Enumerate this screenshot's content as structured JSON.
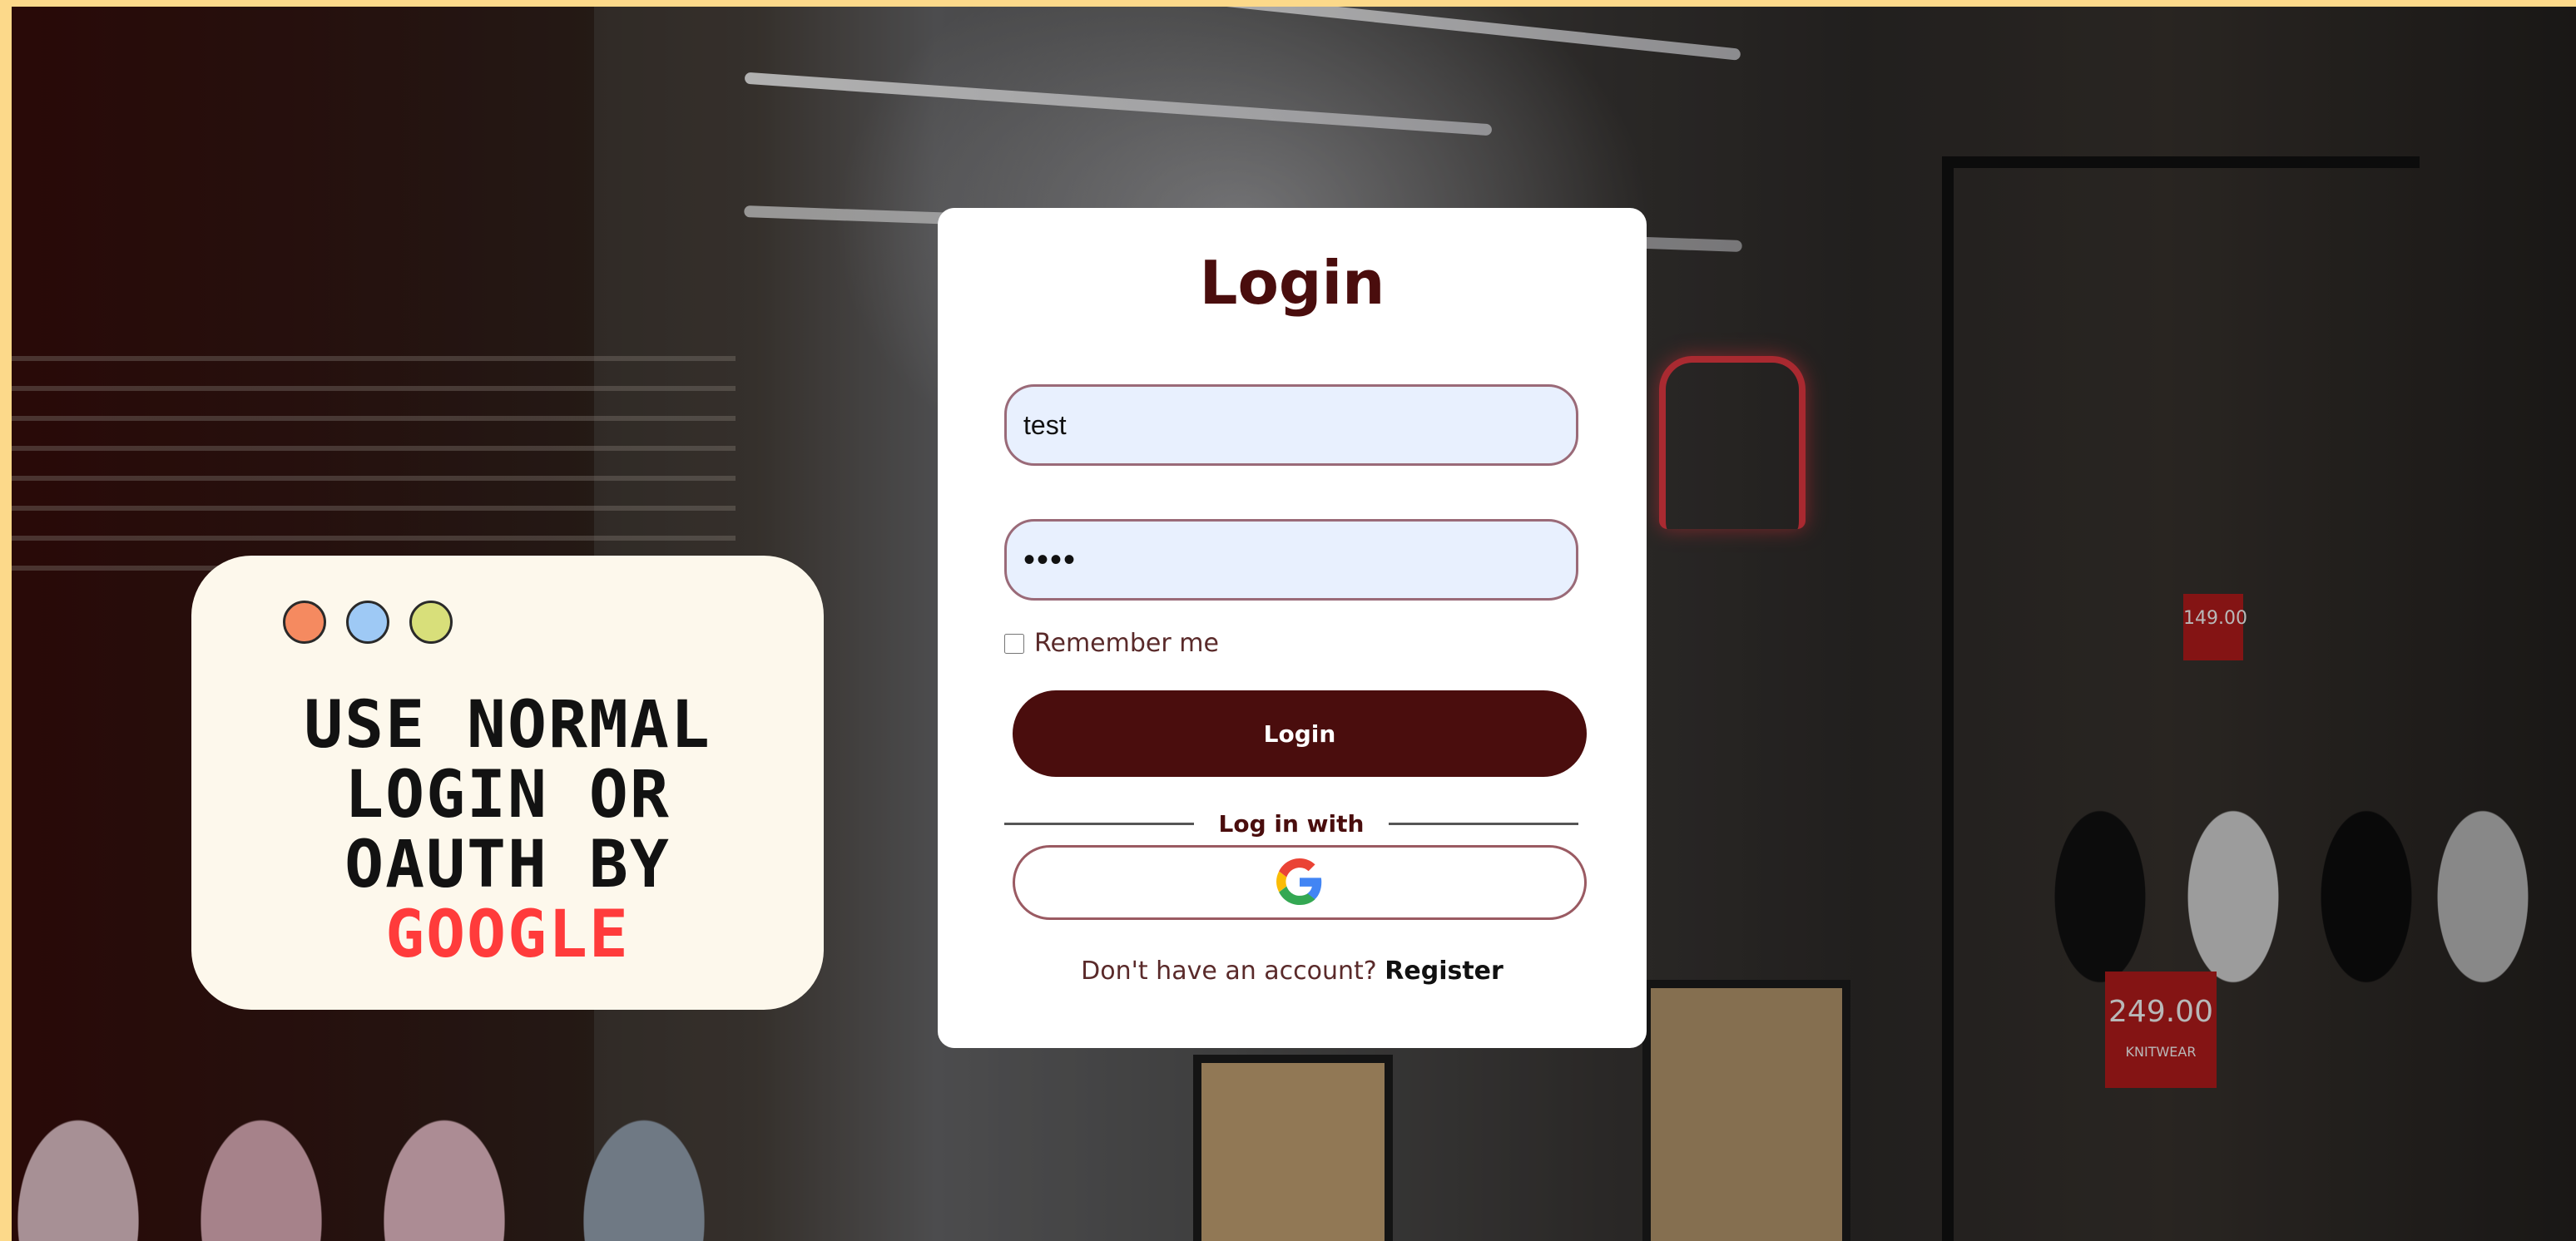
{
  "info_card": {
    "dot_colors": [
      "#f58a60",
      "#9ec9f5",
      "#d8df7a"
    ],
    "headline_lines": [
      "USE NORMAL",
      "LOGIN OR",
      "OAUTH BY"
    ],
    "headline_accent": "GOOGLE",
    "accent_color": "#ff3b3b"
  },
  "login": {
    "title": "Login",
    "username_value": "test",
    "password_value": "test",
    "remember_label": "Remember me",
    "remember_checked": false,
    "submit_label": "Login",
    "divider_label": "Log in with",
    "oauth_provider_icon": "google-icon",
    "register_prompt": "Don't have an account?",
    "register_link": "Register",
    "brand_color": "#4a0d0d"
  },
  "background_signs": {
    "price_tag_1": "149.00",
    "price_tag_2": "249.00",
    "price_tag_2_sub": "KNITWEAR"
  }
}
